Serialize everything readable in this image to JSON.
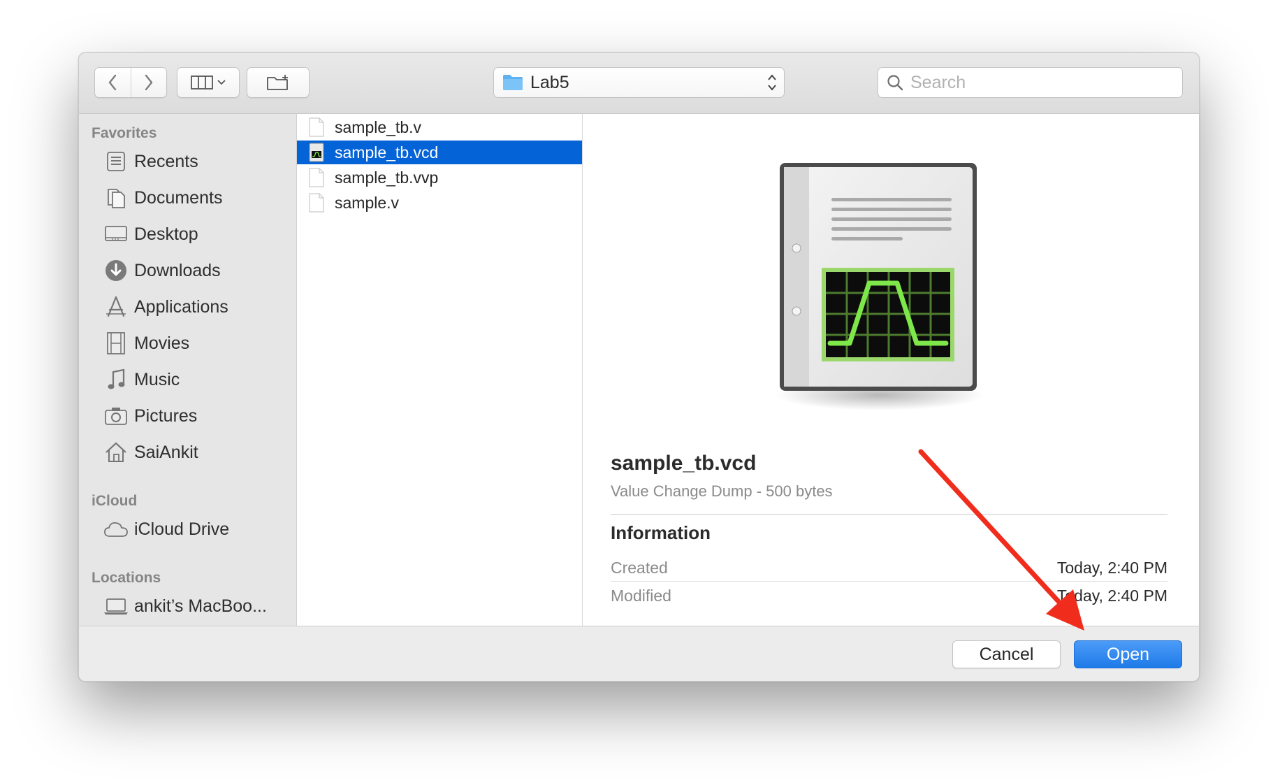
{
  "toolbar": {
    "back_icon": "chevron-left-icon",
    "forward_icon": "chevron-right-icon",
    "view_icon": "column-view-icon",
    "new_folder_icon": "new-folder-icon",
    "location": "Lab5",
    "search_placeholder": "Search"
  },
  "sidebar": {
    "sections": [
      {
        "heading": "Favorites"
      },
      {
        "heading": "iCloud"
      },
      {
        "heading": "Locations"
      }
    ],
    "items": [
      {
        "label": "Recents",
        "icon": "recents-icon"
      },
      {
        "label": "Documents",
        "icon": "documents-icon"
      },
      {
        "label": "Desktop",
        "icon": "desktop-icon"
      },
      {
        "label": "Downloads",
        "icon": "downloads-icon"
      },
      {
        "label": "Applications",
        "icon": "applications-icon"
      },
      {
        "label": "Movies",
        "icon": "movies-icon"
      },
      {
        "label": "Music",
        "icon": "music-icon"
      },
      {
        "label": "Pictures",
        "icon": "pictures-icon"
      },
      {
        "label": "SaiAnkit",
        "icon": "home-icon"
      },
      {
        "label": "iCloud Drive",
        "icon": "cloud-icon"
      },
      {
        "label": "ankit’s MacBoo...",
        "icon": "laptop-icon"
      }
    ]
  },
  "files": [
    {
      "name": "sample_tb.v",
      "selected": false
    },
    {
      "name": "sample_tb.vcd",
      "selected": true
    },
    {
      "name": "sample_tb.vvp",
      "selected": false
    },
    {
      "name": "sample.v",
      "selected": false
    }
  ],
  "preview": {
    "name": "sample_tb.vcd",
    "kind": "Value Change Dump - 500 bytes",
    "info_heading": "Information",
    "rows": [
      {
        "key": "Created",
        "value": "Today, 2:40 PM"
      },
      {
        "key": "Modified",
        "value": "Today, 2:40 PM"
      }
    ]
  },
  "footer": {
    "cancel_label": "Cancel",
    "open_label": "Open"
  },
  "colors": {
    "selection": "#0463d6",
    "primary_button": "#1f7ae8",
    "annotation_arrow": "#f02d1c",
    "waveform": "#7ee84a"
  }
}
